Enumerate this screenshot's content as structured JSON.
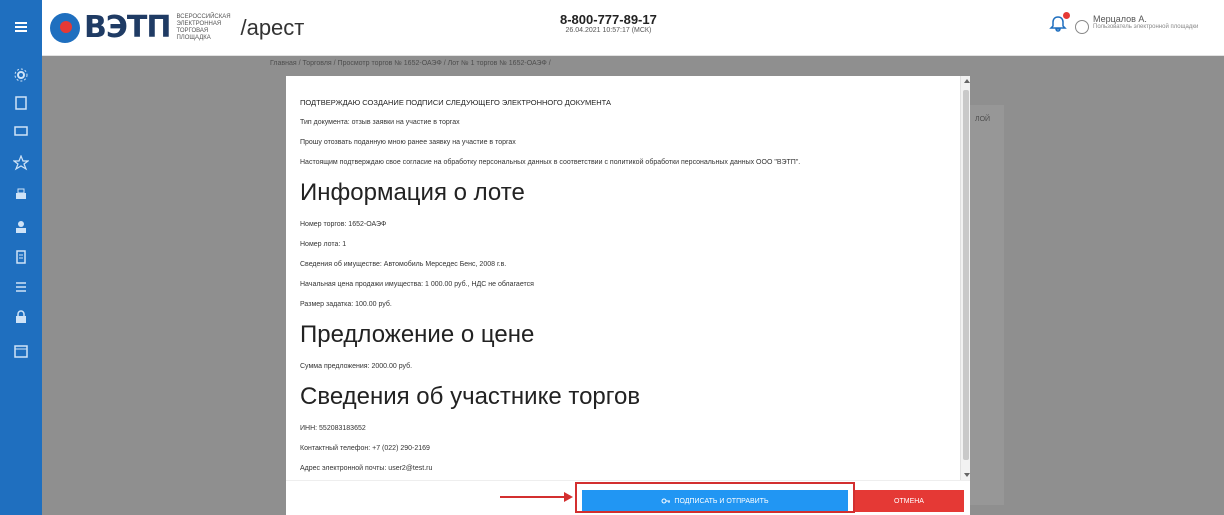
{
  "header": {
    "logo_text": "ВЭТП",
    "logo_sub": [
      "ВСЕРОССИЙСКАЯ",
      "ЭЛЕКТРОННАЯ",
      "ТОРГОВАЯ ПЛОЩАДКА"
    ],
    "app_path": "/арест",
    "phone": "8-800-777-89-17",
    "datetime": "26.04.2021 10:57:17 (МСК)",
    "user_name": "Мерцалов А.",
    "user_role": "Пользователь электронной площадки"
  },
  "breadcrumb": "Главная / Торговля / Просмотр торгов № 1652-ОАЭФ / Лот № 1 торгов № 1652-ОАЭФ /",
  "background": {
    "hint_text": "ЛОЙ"
  },
  "modal": {
    "confirm_title": "ПОДТВЕРЖДАЮ СОЗДАНИЕ ПОДПИСИ СЛЕДУЮЩЕГО ЭЛЕКТРОННОГО ДОКУМЕНТА",
    "doc_type": "Тип документа: отзыв заявки на участие в торгах",
    "request": "Прошу отозвать поданную мною ранее заявку на участие в торгах",
    "consent": "Настоящим подтверждаю свое согласие на обработку персональных данных в соответствии с политикой обработки персональных данных ООО \"ВЭТП\".",
    "lot_heading": "Информация о лоте",
    "auction_number": "Номер торгов: 1652-ОАЭФ",
    "lot_number": "Номер лота: 1",
    "property": "Сведения об имуществе: Автомобиль Мерседес Бенс, 2008 г.в.",
    "start_price": "Начальная цена продажи имущества: 1 000.00 руб., НДС не облагается",
    "deposit": "Размер задатка: 100.00 руб.",
    "price_heading": "Предложение о цене",
    "offer_sum": "Сумма предложения: 2000.00 руб.",
    "participant_heading": "Сведения об участнике торгов",
    "inn": "ИНН: 552083183652",
    "contact_phone": "Контактный телефон: +7 (022) 290-2169",
    "email": "Адрес электронной почты: user2@test.ru",
    "sign_button": "ПОДПИСАТЬ И ОТПРАВИТЬ",
    "cancel_button": "ОТМЕНА"
  },
  "colors": {
    "primary": "#2196f3",
    "danger": "#e53935",
    "sidebar": "#1f6fbf",
    "annotation": "#d32f2f"
  },
  "icons": {
    "sidebar": [
      "menu-icon",
      "settings-icon",
      "document-icon",
      "card-icon",
      "star-icon",
      "printer-icon",
      "user-icon",
      "report-icon",
      "list-icon",
      "lock-icon",
      "calendar-icon"
    ]
  }
}
